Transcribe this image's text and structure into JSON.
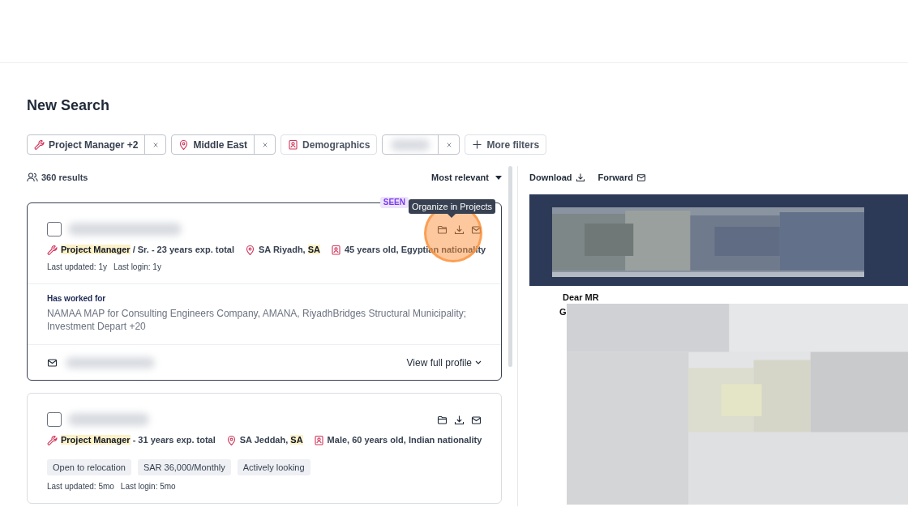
{
  "page_title": "New Search",
  "filters": [
    {
      "kind": "chip",
      "label": "Project Manager +2",
      "removable": true
    },
    {
      "kind": "chip",
      "label": "Middle East",
      "removable": true
    },
    {
      "kind": "chip",
      "label": "Demographics",
      "removable": false
    },
    {
      "kind": "blurred",
      "removable": true
    },
    {
      "kind": "add",
      "label": "More filters",
      "removable": false
    }
  ],
  "results_count": "360 results",
  "sort": "Most relevant",
  "candidates": [
    {
      "selected": false,
      "badge": "SEEN",
      "tooltip": "Organize in Projects",
      "role": [
        {
          "text": "Project Manager",
          "highlighted": true
        },
        {
          "text": " / Sr. - 23 years exp. total",
          "highlighted": false
        }
      ],
      "location": [
        {
          "text": "SA Riyadh, ",
          "highlighted": false
        },
        {
          "text": "SA",
          "highlighted": true
        }
      ],
      "demographics": "45 years old, Egyptian nationality",
      "activity": [
        "Last updated: 1y",
        "Last login: 1y"
      ],
      "worked_for_label": "Has worked for",
      "worked_for": "NAMAA MAP for Consulting Engineers Company, AMANA, RiyadhBridges Structural Municipality; Investment Depart +20",
      "view_profile": "View full profile",
      "active": true
    },
    {
      "selected": false,
      "role": [
        {
          "text": "Project Manager",
          "highlighted": true
        },
        {
          "text": " - 31 years exp. total",
          "highlighted": false
        }
      ],
      "location": [
        {
          "text": "SA Jeddah, ",
          "highlighted": false
        },
        {
          "text": "SA",
          "highlighted": true
        }
      ],
      "demographics": "Male, 60 years old, Indian nationality",
      "tags": [
        "Open to relocation",
        "SAR 36,000/Monthly",
        "Actively looking"
      ],
      "activity": [
        "Last updated: 5mo",
        "Last login: 5mo"
      ],
      "active": false
    }
  ],
  "preview": {
    "actions": [
      "Download",
      "Forward"
    ],
    "greeting": "Dear MR",
    "letter": "G"
  }
}
